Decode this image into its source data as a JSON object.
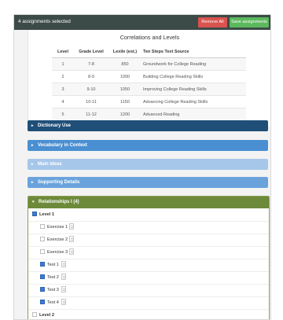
{
  "header": {
    "selected_count": "4 assignments selected",
    "remove_all_label": "Remove All",
    "save_label": "Save assignments",
    "colors": {
      "bar": "#3c4a48",
      "remove": "#d9534f",
      "save": "#5cb85c"
    }
  },
  "correlations": {
    "title": "Correlations and Levels",
    "columns": [
      "Level",
      "Grade Level",
      "Lexile (est.)",
      "Ten Steps Text Source"
    ],
    "rows": [
      [
        "1",
        "7-8",
        "850",
        "Groundwork for College Reading"
      ],
      [
        "2",
        "8-9",
        "1000",
        "Building College Reading Skills"
      ],
      [
        "3",
        "9-10",
        "1050",
        "Improving College Reading Skills"
      ],
      [
        "4",
        "10-11",
        "1150",
        "Advancing College Reading Skills"
      ],
      [
        "5",
        "11-12",
        "1200",
        "Advanced Reading"
      ]
    ]
  },
  "sections": [
    {
      "label": "Dictionary Use"
    },
    {
      "label": "Vocabulary in Context"
    },
    {
      "label": "Main Ideas"
    },
    {
      "label": "Supporting Details"
    }
  ],
  "relationships": {
    "label": "Relationships I (4)",
    "items": [
      {
        "type": "level",
        "label": "Level 1",
        "checked": true
      },
      {
        "type": "item",
        "label": "Exercise 1",
        "checked": false
      },
      {
        "type": "item",
        "label": "Exercise 2",
        "checked": false
      },
      {
        "type": "item",
        "label": "Exercise 3",
        "checked": false
      },
      {
        "type": "item",
        "label": "Test 1",
        "checked": true
      },
      {
        "type": "item",
        "label": "Test 2",
        "checked": true
      },
      {
        "type": "item",
        "label": "Test 3",
        "checked": true
      },
      {
        "type": "item",
        "label": "Test 4",
        "checked": true
      },
      {
        "type": "level",
        "label": "Level 2",
        "checked": false
      }
    ]
  }
}
